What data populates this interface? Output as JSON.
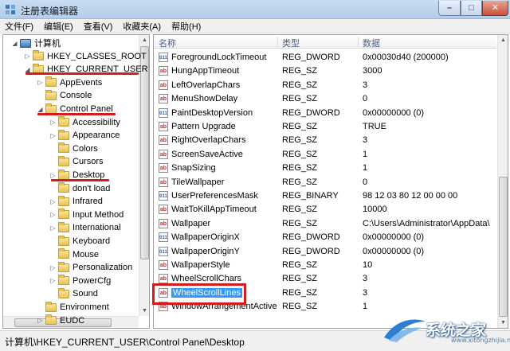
{
  "window": {
    "title": "注册表编辑器"
  },
  "menu": [
    "文件(F)",
    "编辑(E)",
    "查看(V)",
    "收藏夹(A)",
    "帮助(H)"
  ],
  "tree": [
    {
      "label": "计算机",
      "level": 0,
      "expander": "open",
      "icon": "computer-icon"
    },
    {
      "label": "HKEY_CLASSES_ROOT",
      "level": 1,
      "expander": "closed",
      "icon": "folder-icon"
    },
    {
      "label": "HKEY_CURRENT_USER",
      "level": 1,
      "expander": "open",
      "icon": "folder-icon"
    },
    {
      "label": "AppEvents",
      "level": 2,
      "expander": "closed",
      "icon": "folder-icon"
    },
    {
      "label": "Console",
      "level": 2,
      "expander": "none",
      "icon": "folder-icon"
    },
    {
      "label": "Control Panel",
      "level": 2,
      "expander": "open",
      "icon": "folder-icon"
    },
    {
      "label": "Accessibility",
      "level": 3,
      "expander": "closed",
      "icon": "folder-icon"
    },
    {
      "label": "Appearance",
      "level": 3,
      "expander": "closed",
      "icon": "folder-icon"
    },
    {
      "label": "Colors",
      "level": 3,
      "expander": "none",
      "icon": "folder-icon"
    },
    {
      "label": "Cursors",
      "level": 3,
      "expander": "none",
      "icon": "folder-icon"
    },
    {
      "label": "Desktop",
      "level": 3,
      "expander": "closed",
      "icon": "folder-icon"
    },
    {
      "label": "don't load",
      "level": 3,
      "expander": "none",
      "icon": "folder-icon"
    },
    {
      "label": "Infrared",
      "level": 3,
      "expander": "closed",
      "icon": "folder-icon"
    },
    {
      "label": "Input Method",
      "level": 3,
      "expander": "closed",
      "icon": "folder-icon"
    },
    {
      "label": "International",
      "level": 3,
      "expander": "closed",
      "icon": "folder-icon"
    },
    {
      "label": "Keyboard",
      "level": 3,
      "expander": "none",
      "icon": "folder-icon"
    },
    {
      "label": "Mouse",
      "level": 3,
      "expander": "none",
      "icon": "folder-icon"
    },
    {
      "label": "Personalization",
      "level": 3,
      "expander": "closed",
      "icon": "folder-icon"
    },
    {
      "label": "PowerCfg",
      "level": 3,
      "expander": "closed",
      "icon": "folder-icon"
    },
    {
      "label": "Sound",
      "level": 3,
      "expander": "none",
      "icon": "folder-icon"
    },
    {
      "label": "Environment",
      "level": 2,
      "expander": "none",
      "icon": "folder-icon"
    },
    {
      "label": "EUDC",
      "level": 2,
      "expander": "closed",
      "icon": "folder-icon"
    }
  ],
  "list": {
    "columns": [
      "名称",
      "类型",
      "数据"
    ],
    "rows": [
      {
        "name": "ForegroundLockTimeout",
        "type": "REG_DWORD",
        "data": "0x00030d40 (200000)",
        "icon": "dword"
      },
      {
        "name": "HungAppTimeout",
        "type": "REG_SZ",
        "data": "3000",
        "icon": "sz"
      },
      {
        "name": "LeftOverlapChars",
        "type": "REG_SZ",
        "data": "3",
        "icon": "sz"
      },
      {
        "name": "MenuShowDelay",
        "type": "REG_SZ",
        "data": "0",
        "icon": "sz"
      },
      {
        "name": "PaintDesktopVersion",
        "type": "REG_DWORD",
        "data": "0x00000000 (0)",
        "icon": "dword"
      },
      {
        "name": "Pattern Upgrade",
        "type": "REG_SZ",
        "data": "TRUE",
        "icon": "sz"
      },
      {
        "name": "RightOverlapChars",
        "type": "REG_SZ",
        "data": "3",
        "icon": "sz"
      },
      {
        "name": "ScreenSaveActive",
        "type": "REG_SZ",
        "data": "1",
        "icon": "sz"
      },
      {
        "name": "SnapSizing",
        "type": "REG_SZ",
        "data": "1",
        "icon": "sz"
      },
      {
        "name": "TileWallpaper",
        "type": "REG_SZ",
        "data": "0",
        "icon": "sz"
      },
      {
        "name": "UserPreferencesMask",
        "type": "REG_BINARY",
        "data": "98 12 03 80 12 00 00 00",
        "icon": "dword"
      },
      {
        "name": "WaitToKillAppTimeout",
        "type": "REG_SZ",
        "data": "10000",
        "icon": "sz"
      },
      {
        "name": "Wallpaper",
        "type": "REG_SZ",
        "data": "C:\\Users\\Administrator\\AppData\\",
        "icon": "sz"
      },
      {
        "name": "WallpaperOriginX",
        "type": "REG_DWORD",
        "data": "0x00000000 (0)",
        "icon": "dword"
      },
      {
        "name": "WallpaperOriginY",
        "type": "REG_DWORD",
        "data": "0x00000000 (0)",
        "icon": "dword"
      },
      {
        "name": "WallpaperStyle",
        "type": "REG_SZ",
        "data": "10",
        "icon": "sz"
      },
      {
        "name": "WheelScrollChars",
        "type": "REG_SZ",
        "data": "3",
        "icon": "sz"
      },
      {
        "name": "WheelScrollLines",
        "type": "REG_SZ",
        "data": "3",
        "icon": "sz",
        "selected": true
      },
      {
        "name": "WindowArrangementActive",
        "type": "REG_SZ",
        "data": "1",
        "icon": "sz"
      }
    ]
  },
  "status": {
    "path": "计算机\\HKEY_CURRENT_USER\\Control Panel\\Desktop"
  },
  "watermark": {
    "text": "系统之家",
    "url": "www.xitongzhijia.net"
  },
  "colors": {
    "annotation_red": "#d61b1b",
    "selection_blue": "#3399ff",
    "header_text": "#4d6082"
  }
}
